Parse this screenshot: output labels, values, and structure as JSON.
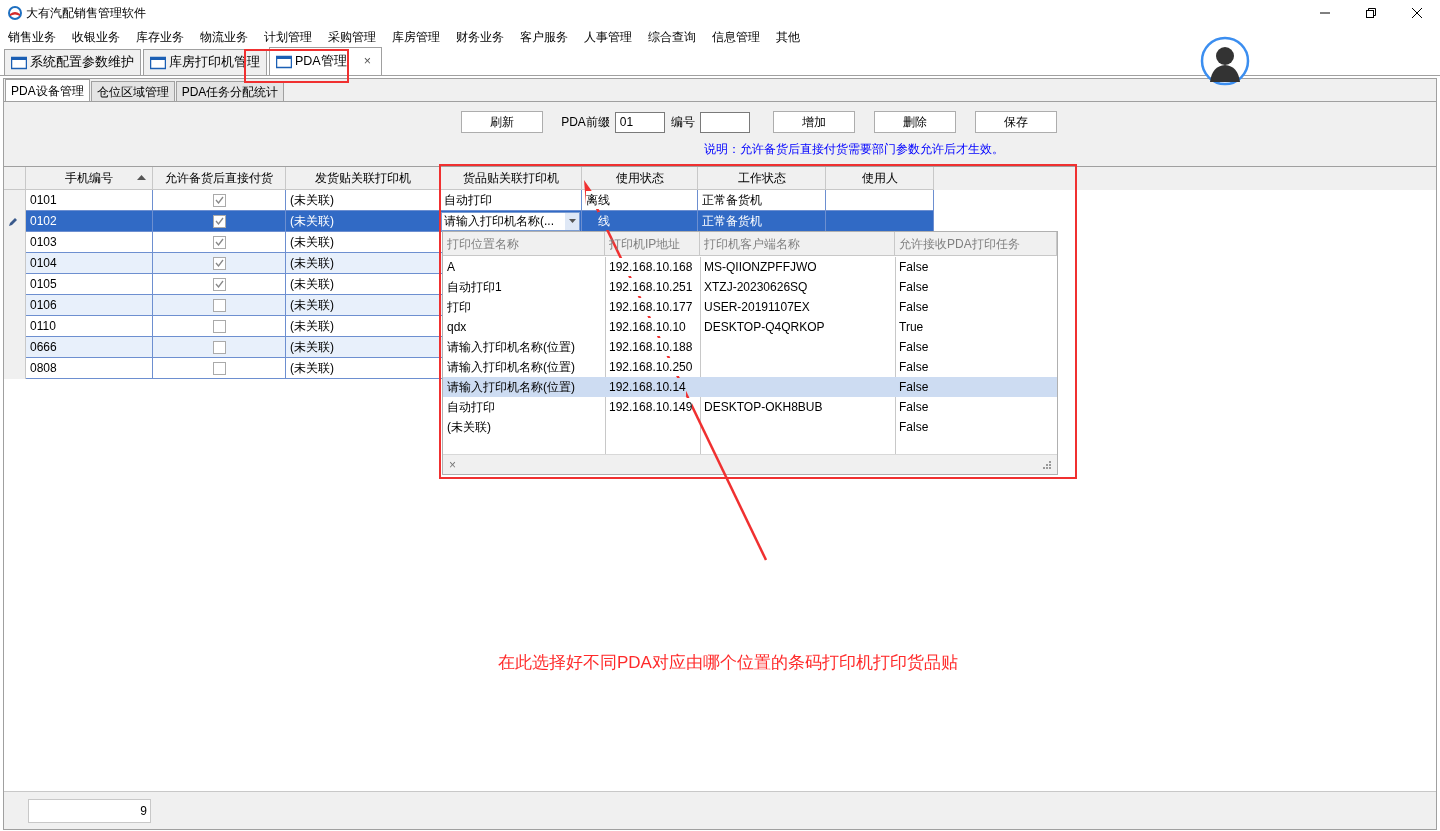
{
  "window": {
    "title": "大有汽配销售管理软件"
  },
  "menu": [
    "销售业务",
    "收银业务",
    "库存业务",
    "物流业务",
    "计划管理",
    "采购管理",
    "库房管理",
    "财务业务",
    "客户服务",
    "人事管理",
    "综合查询",
    "信息管理",
    "其他"
  ],
  "tabs": [
    {
      "label": "系统配置参数维护",
      "selected": false
    },
    {
      "label": "库房打印机管理",
      "selected": false
    },
    {
      "label": "PDA管理",
      "selected": true,
      "close": "×"
    }
  ],
  "subtabs": [
    {
      "label": "PDA设备管理",
      "selected": true
    },
    {
      "label": "仓位区域管理",
      "selected": false
    },
    {
      "label": "PDA任务分配统计",
      "selected": false
    }
  ],
  "toolbar": {
    "refresh": "刷新",
    "prefix_label": "PDA前缀",
    "prefix_value": "01",
    "number_label": "编号",
    "add": "增加",
    "delete": "删除",
    "save": "保存",
    "note": "说明：允许备货后直接付货需要部门参数允许后才生效。"
  },
  "grid": {
    "columns": [
      "手机编号",
      "允许备货后直接付货",
      "发货贴关联打印机",
      "货品贴关联打印机",
      "使用状态",
      "工作状态",
      "使用人"
    ],
    "rows": [
      {
        "phone": "0101",
        "checked": true,
        "ship_printer": "(未关联)",
        "goods_printer": "自动打印",
        "usage": "离线",
        "work": "正常备货机",
        "selected": false
      },
      {
        "phone": "0102",
        "checked": true,
        "ship_printer": "(未关联)",
        "goods_printer": "请输入打印机名称(...",
        "usage": "线",
        "work": "正常备货机",
        "selected": true
      },
      {
        "phone": "0103",
        "checked": true,
        "ship_printer": "(未关联)",
        "selected": false
      },
      {
        "phone": "0104",
        "checked": true,
        "ship_printer": "(未关联)",
        "selected": false
      },
      {
        "phone": "0105",
        "checked": true,
        "ship_printer": "(未关联)",
        "selected": false
      },
      {
        "phone": "0106",
        "checked": false,
        "ship_printer": "(未关联)",
        "selected": false
      },
      {
        "phone": "0110",
        "checked": false,
        "ship_printer": "(未关联)",
        "selected": false
      },
      {
        "phone": "0666",
        "checked": false,
        "ship_printer": "(未关联)",
        "selected": false
      },
      {
        "phone": "0808",
        "checked": false,
        "ship_printer": "(未关联)",
        "selected": false
      }
    ]
  },
  "dropdown": {
    "columns": [
      "打印位置名称",
      "打印机IP地址",
      "打印机客户端名称",
      "允许接收PDA打印任务"
    ],
    "rows": [
      {
        "cells": [
          "A",
          "192.168.10.168",
          "MS-QIIONZPFFJWO",
          "False"
        ],
        "selected": false
      },
      {
        "cells": [
          "自动打印1",
          "192.168.10.251",
          "XTZJ-20230626SQ",
          "False"
        ],
        "selected": false
      },
      {
        "cells": [
          "打印",
          "192.168.10.177",
          "USER-20191107EX",
          "False"
        ],
        "selected": false
      },
      {
        "cells": [
          "qdx",
          "192.168.10.10",
          "DESKTOP-Q4QRKOP",
          "True"
        ],
        "selected": false
      },
      {
        "cells": [
          "请输入打印机名称(位置)",
          "192.168.10.188",
          "",
          "False"
        ],
        "selected": false
      },
      {
        "cells": [
          "请输入打印机名称(位置)",
          "192.168.10.250",
          "",
          "False"
        ],
        "selected": false
      },
      {
        "cells": [
          "请输入打印机名称(位置)",
          "192.168.10.14",
          "",
          "False"
        ],
        "selected": true
      },
      {
        "cells": [
          "自动打印",
          "192.168.10.149",
          "DESKTOP-OKH8BUB",
          "False"
        ],
        "selected": false
      },
      {
        "cells": [
          "(未关联)",
          "",
          "",
          "False"
        ],
        "selected": false
      }
    ],
    "close": "×"
  },
  "status": {
    "count": "9"
  },
  "annotation": "在此选择好不同PDA对应由哪个位置的条码打印机打印货品贴"
}
